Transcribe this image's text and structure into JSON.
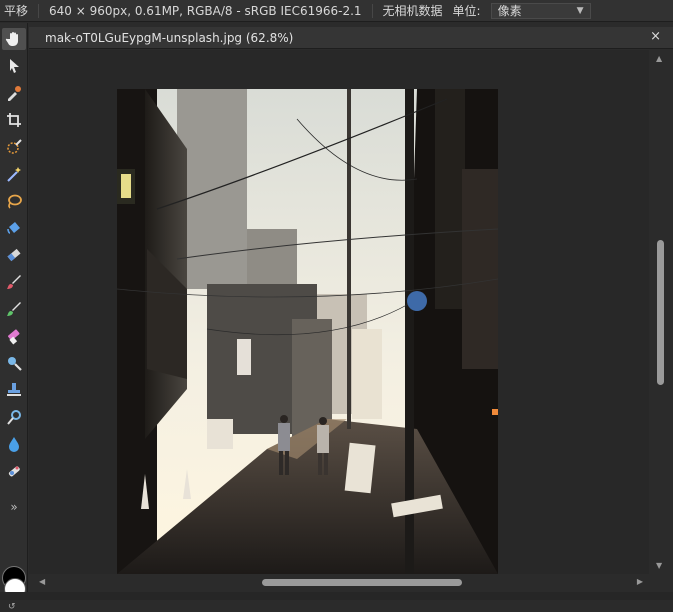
{
  "topbar": {
    "tool_name": "平移",
    "image_info": "640 × 960px, 0.61MP, RGBA/8 - sRGB IEC61966-2.1",
    "camera_info": "无相机数据",
    "unit_label": "单位:",
    "unit_value": "像素"
  },
  "document": {
    "tab_title": "mak-oT0LGuEypgM-unsplash.jpg (62.8%)",
    "close_glyph": "×"
  },
  "toolbar": {
    "tools": [
      "hand-icon",
      "move-pointer-icon",
      "color-picker-icon",
      "crop-icon",
      "selection-brush-icon",
      "magic-wand-icon",
      "freehand-selection-icon",
      "flood-fill-icon",
      "gradient-icon",
      "paint-brush-icon",
      "pixel-brush-icon",
      "eraser-icon",
      "smudge-icon",
      "clone-stamp-icon",
      "dodge-icon",
      "blur-icon",
      "healing-icon"
    ],
    "more_glyph": "»"
  },
  "colors": {
    "foreground": "#000000",
    "background": "#ffffff",
    "accent": "#5a5a5a"
  }
}
